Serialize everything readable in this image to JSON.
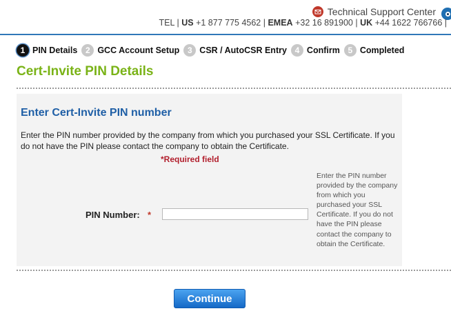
{
  "header": {
    "support_label": "Technical Support Center",
    "tel_prefix": "TEL |",
    "us_label": "US",
    "us_phone": "+1 877 775 4562 |",
    "emea_label": "EMEA",
    "emea_phone": "+32 16 891900 |",
    "uk_label": "UK",
    "uk_phone": "+44 1622 766766 |"
  },
  "steps": [
    {
      "num": "1",
      "label": "PIN Details",
      "active": true
    },
    {
      "num": "2",
      "label": "GCC Account Setup",
      "active": false
    },
    {
      "num": "3",
      "label": "CSR / AutoCSR Entry",
      "active": false
    },
    {
      "num": "4",
      "label": "Confirm",
      "active": false
    },
    {
      "num": "5",
      "label": "Completed",
      "active": false
    }
  ],
  "page_title": "Cert-Invite PIN Details",
  "panel": {
    "title": "Enter Cert-Invite PIN number",
    "description": "Enter the PIN number provided by the company from which you purchased your SSL Certificate. If you do not have the PIN please contact the company to obtain the Certificate.",
    "required_star": "*",
    "required_label": "Required field",
    "pin_label": "PIN Number:",
    "pin_star": "*",
    "pin_value": "",
    "help_text": "Enter the PIN number provided by the company from which you purchased your SSL Certificate. If you do not have the PIN please contact the company to obtain the Certificate."
  },
  "continue_label": "Continue",
  "colors": {
    "accent_blue": "#2f77b8",
    "title_green": "#7ab317",
    "required_red": "#b21f2d"
  }
}
